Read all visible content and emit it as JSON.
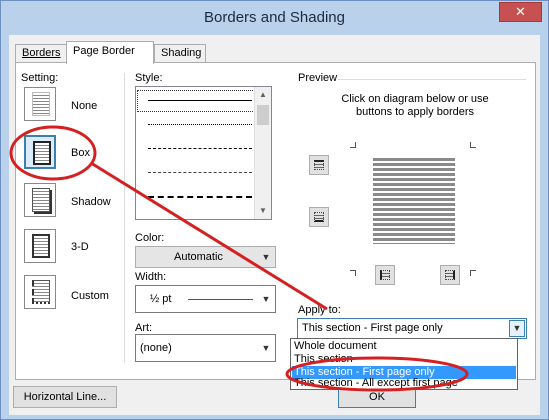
{
  "window": {
    "title": "Borders and Shading",
    "close_glyph": "✕"
  },
  "tabs": [
    {
      "label": "Borders"
    },
    {
      "label": "Page Border"
    },
    {
      "label": "Shading"
    }
  ],
  "setting": {
    "label": "Setting:",
    "items": [
      {
        "label": "None"
      },
      {
        "label": "Box"
      },
      {
        "label": "Shadow"
      },
      {
        "label": "3-D"
      },
      {
        "label": "Custom"
      }
    ],
    "selected": "Box"
  },
  "style": {
    "label": "Style:"
  },
  "color": {
    "label": "Color:",
    "value": "Automatic"
  },
  "width": {
    "label": "Width:",
    "value": "½ pt"
  },
  "art": {
    "label": "Art:",
    "value": "(none)"
  },
  "preview": {
    "label": "Preview",
    "instructions": "Click on diagram below or use buttons to apply borders"
  },
  "apply_to": {
    "label": "Apply to:",
    "value": "This section - First page only",
    "options": [
      "Whole document",
      "This section",
      "This section - First page only",
      "This section - All except first page"
    ],
    "highlighted": "This section - First page only"
  },
  "footer": {
    "horizontal_line": "Horizontal Line...",
    "ok": "OK"
  },
  "colors": {
    "selection": "#3399ff",
    "annotation": "#d42020",
    "title_bar": "#b9d1ea",
    "close_button": "#c75050"
  }
}
